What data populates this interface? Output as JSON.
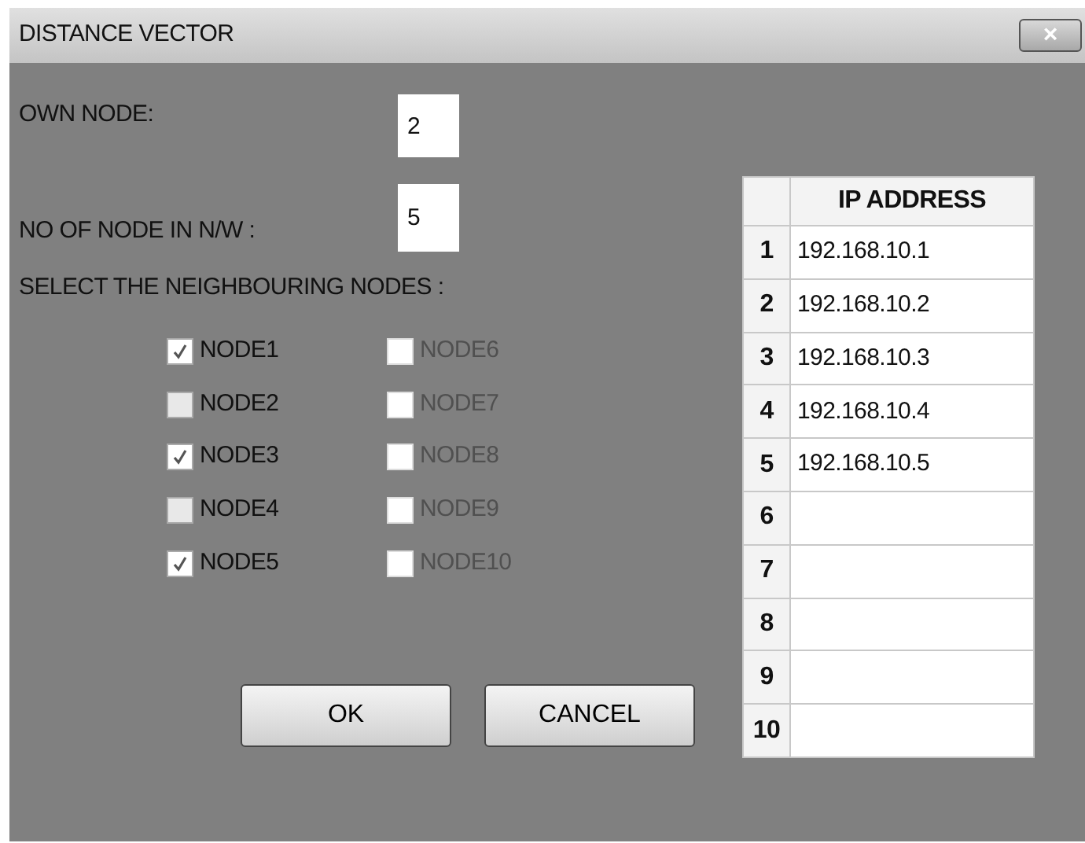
{
  "window": {
    "title": "DISTANCE VECTOR",
    "close": "×"
  },
  "own_node": {
    "label": "OWN NODE:",
    "value": "2"
  },
  "node_count": {
    "label": "NO OF NODE IN N/W :",
    "value": "5"
  },
  "neighbours_label": "SELECT THE NEIGHBOURING NODES :",
  "nodes": [
    {
      "label": "NODE1",
      "checked": true,
      "disabled": false
    },
    {
      "label": "NODE2",
      "checked": false,
      "disabled": false
    },
    {
      "label": "NODE3",
      "checked": true,
      "disabled": false
    },
    {
      "label": "NODE4",
      "checked": false,
      "disabled": false
    },
    {
      "label": "NODE5",
      "checked": true,
      "disabled": false
    },
    {
      "label": "NODE6",
      "checked": false,
      "disabled": true
    },
    {
      "label": "NODE7",
      "checked": false,
      "disabled": true
    },
    {
      "label": "NODE8",
      "checked": false,
      "disabled": true
    },
    {
      "label": "NODE9",
      "checked": false,
      "disabled": true
    },
    {
      "label": "NODE10",
      "checked": false,
      "disabled": true
    }
  ],
  "buttons": [
    "OK",
    "CANCEL"
  ],
  "table": {
    "columns": [
      "IP ADDRESS"
    ],
    "rows": [
      {
        "number": "1",
        "ip": "192.168.10.1"
      },
      {
        "number": "2",
        "ip": "192.168.10.2"
      },
      {
        "number": "3",
        "ip": "192.168.10.3"
      },
      {
        "number": "4",
        "ip": "192.168.10.4"
      },
      {
        "number": "5",
        "ip": "192.168.10.5"
      },
      {
        "number": "6"
      },
      {
        "number": "7"
      },
      {
        "number": "8"
      },
      {
        "number": "9"
      },
      {
        "number": "10"
      }
    ]
  }
}
